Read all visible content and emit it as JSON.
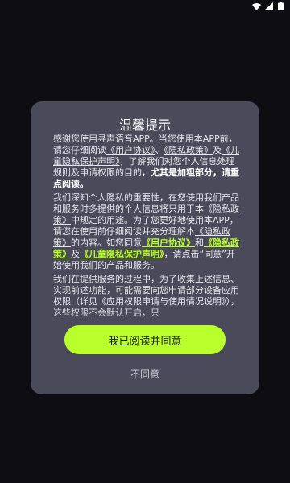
{
  "dialog": {
    "title": "温馨提示",
    "p1": {
      "t1": "感谢您使用寻声语音APP。当您使用本APP前，请您仔细阅读",
      "l1": "《用户协议》",
      "t2": "、",
      "l2": "《隐私政策》",
      "t3": "及",
      "l3": "《儿童隐私保护声明》",
      "t4": "，了解我们对您个人信息处理规则及申请权限的目的，",
      "b1": "尤其是加粗部分，请重点阅读。"
    },
    "p2": {
      "t1": "我们深知个人隐私的重要性，在您使用我们产品和服务时多提供的个人信息将只用于本",
      "l1": "《隐私政策》",
      "t2": "中规定的用途。为了您更好地使用本APP，请您在使用前仔细阅读并充分理解本",
      "l2": "《隐私政策》",
      "t3": "的内容。如您同意",
      "h1": "《用户协议》",
      "t4": "和",
      "h2": "《隐私政策》",
      "t5": "及",
      "h3": "《儿童隐私保护声明》",
      "t6": "，请点击“同意”开始使用我们的产品和服务。"
    },
    "p3": {
      "t1": "我们在提供服务的过程中，为了收集上述信息、实现前述功能，可能需要向您申请部分设备应用权限（详见《应用权限申请与使用情况说明》），这些权限不会默认开启，只"
    },
    "agree_label": "我已阅读并同意",
    "disagree_label": "不同意"
  },
  "colors": {
    "background": "#0e0e12",
    "dialog": "#4a4a5b",
    "accent": "#b8ff2c"
  },
  "icons": [
    "wifi-icon",
    "signal-icon",
    "battery-icon"
  ]
}
